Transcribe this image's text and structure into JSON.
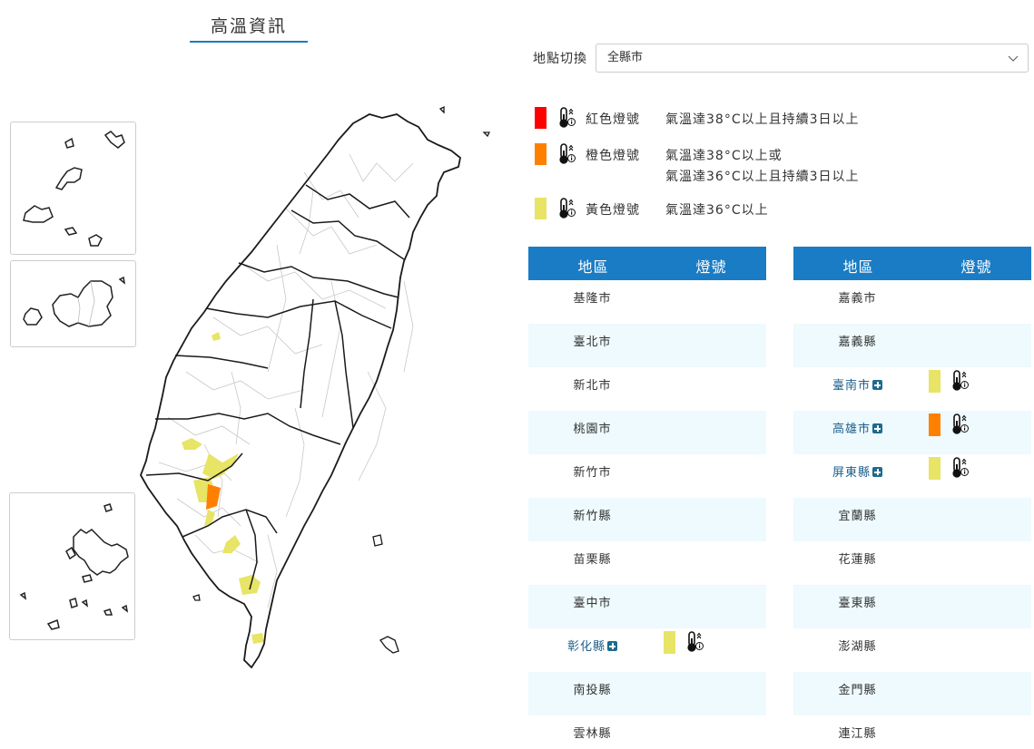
{
  "page": {
    "title": "高溫資訊"
  },
  "location": {
    "label": "地點切換",
    "selected": "全縣市"
  },
  "colors": {
    "red": "#ff0000",
    "orange": "#ff8000",
    "yellow": "#e8e465",
    "header": "#1a7cc4"
  },
  "legend": [
    {
      "name": "紅色燈號",
      "color": "red",
      "desc": [
        "氣溫達38°C以上且持續3日以上"
      ]
    },
    {
      "name": "橙色燈號",
      "color": "orange",
      "desc": [
        "氣溫達38°C以上或",
        "氣溫達36°C以上且持續3日以上"
      ]
    },
    {
      "name": "黃色燈號",
      "color": "yellow",
      "desc": [
        "氣溫達36°C以上"
      ]
    }
  ],
  "table": {
    "col_region": "地區",
    "col_signal": "燈號",
    "left": [
      {
        "name": "基隆市"
      },
      {
        "name": "臺北市"
      },
      {
        "name": "新北市"
      },
      {
        "name": "桃園市"
      },
      {
        "name": "新竹市"
      },
      {
        "name": "新竹縣"
      },
      {
        "name": "苗栗縣"
      },
      {
        "name": "臺中市"
      },
      {
        "name": "彰化縣",
        "signal": "yellow",
        "expandable": true
      },
      {
        "name": "南投縣"
      },
      {
        "name": "雲林縣"
      }
    ],
    "right": [
      {
        "name": "嘉義市"
      },
      {
        "name": "嘉義縣"
      },
      {
        "name": "臺南市",
        "signal": "yellow",
        "expandable": true
      },
      {
        "name": "高雄市",
        "signal": "orange",
        "expandable": true
      },
      {
        "name": "屏東縣",
        "signal": "yellow",
        "expandable": true
      },
      {
        "name": "宜蘭縣"
      },
      {
        "name": "花蓮縣"
      },
      {
        "name": "臺東縣"
      },
      {
        "name": "澎湖縣"
      },
      {
        "name": "金門縣"
      },
      {
        "name": "連江縣"
      }
    ]
  },
  "icons": {
    "thermometer": "thermometer-icon",
    "expand": "plus-icon",
    "dropdown": "chevron-down-icon"
  }
}
